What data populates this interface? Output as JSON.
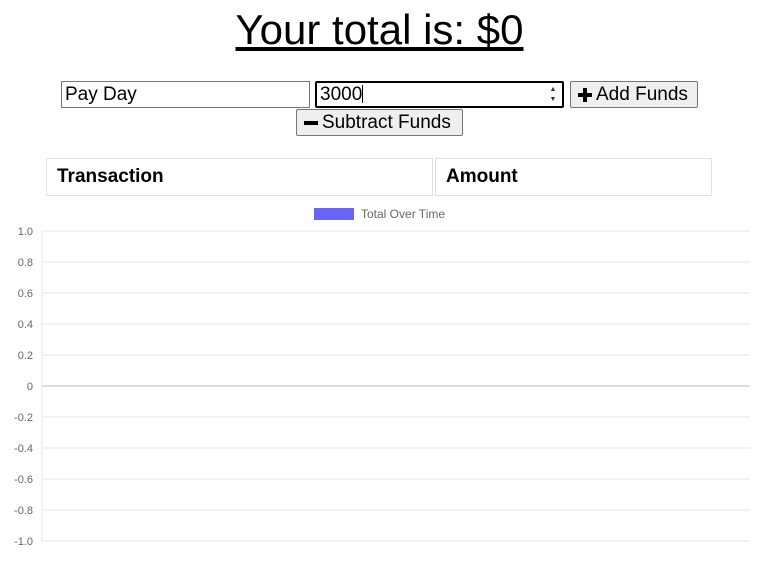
{
  "header": {
    "title": "Your total is: $0"
  },
  "form": {
    "name_value": "Pay Day",
    "amount_value": "3000",
    "add_label": "Add Funds",
    "subtract_label": "Subtract Funds"
  },
  "table": {
    "columns": [
      "Transaction",
      "Amount"
    ]
  },
  "colors": {
    "series": "#6666ff"
  },
  "chart_data": {
    "type": "line",
    "legend": [
      "Total Over Time"
    ],
    "series": [
      {
        "name": "Total Over Time",
        "values": []
      }
    ],
    "ylim": [
      -1.0,
      1.0
    ],
    "yticks": [
      "1.0",
      "0.8",
      "0.6",
      "0.4",
      "0.2",
      "0",
      "-0.2",
      "-0.4",
      "-0.6",
      "-0.8",
      "-1.0"
    ],
    "grid": true,
    "legend_position": "top-center"
  }
}
